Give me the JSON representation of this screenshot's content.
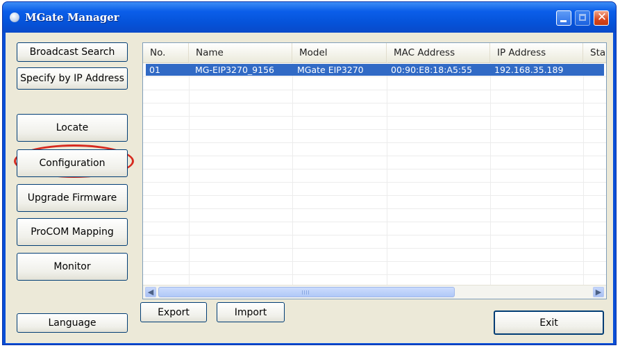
{
  "window": {
    "title": "MGate Manager"
  },
  "title_buttons": {
    "minimize_icon": "minimize-icon",
    "maximize_icon": "maximize-icon",
    "close_icon": "close-icon",
    "close_glyph": "✕"
  },
  "sidebar": {
    "broadcast_search": "Broadcast Search",
    "specify_by_ip": "Specify by IP Address",
    "locate": "Locate",
    "configuration": "Configuration",
    "upgrade_firmware": "Upgrade Firmware",
    "procom_mapping": "ProCOM Mapping",
    "monitor": "Monitor",
    "language": "Language"
  },
  "table": {
    "columns": [
      "No.",
      "Name",
      "Model",
      "MAC Address",
      "IP Address",
      "Sta"
    ],
    "rows": [
      {
        "no": "01",
        "name": "MG-EIP3270_9156",
        "model": "MGate EIP3270",
        "mac": "00:90:E8:18:A5:55",
        "ip": "192.168.35.189",
        "status": ""
      }
    ],
    "scroll_left": "◀",
    "scroll_right": "▶"
  },
  "bottom": {
    "export": "Export",
    "import": "Import",
    "exit": "Exit"
  },
  "colors": {
    "title_bar": "#0b5ee9",
    "selection": "#316ac5",
    "highlight": "#d62a1f",
    "face": "#ece9d8"
  }
}
